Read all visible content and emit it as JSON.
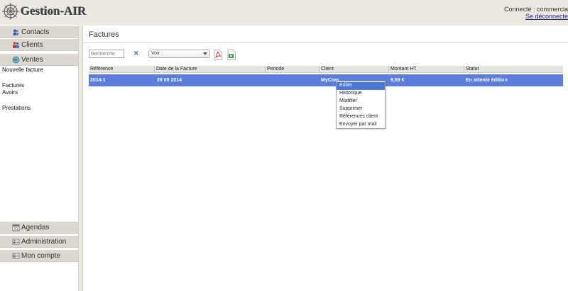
{
  "app": {
    "logo_text": "Gestion-AIR",
    "connected_text": "Connecté : commercia",
    "logout_label": "Se déconnecte"
  },
  "sidebar": {
    "top_items": [
      {
        "label": "Contacts",
        "icon": "contacts-icon"
      },
      {
        "label": "Clients",
        "icon": "clients-icon"
      },
      {
        "label": "Ventes",
        "icon": "ventes-icon"
      }
    ],
    "sub_items": [
      "Nouvelle facture",
      "Factures",
      "Avoirs",
      "Prestations"
    ],
    "bottom_items": [
      {
        "label": "Agendas",
        "icon": "calendar-icon"
      },
      {
        "label": "Administration",
        "icon": "administration-icon"
      },
      {
        "label": "Mon compte",
        "icon": "account-icon"
      }
    ]
  },
  "main": {
    "title": "Factures",
    "search_placeholder": "Recherche",
    "clear_label": "✕",
    "view_select_value": "Voir :",
    "columns": [
      "Référence",
      "Date de la Facture",
      "Periode",
      "Client",
      "Montant HT",
      "Statut"
    ],
    "rows": [
      {
        "reference": "2014-1",
        "date": "28 05 2014",
        "periode": "",
        "client": "MyCom",
        "montant": "9,59 €",
        "statut": "En attente édition"
      }
    ]
  },
  "context_menu": {
    "items": [
      "Editer",
      "Historique",
      "Modifier",
      "Supprimer",
      "Références client",
      "Envoyer par mail"
    ],
    "active_index": 0
  },
  "colors": {
    "selected_row": "#5b7de0",
    "menu_highlight": "#4a79d8",
    "background": "#ece9e1"
  }
}
